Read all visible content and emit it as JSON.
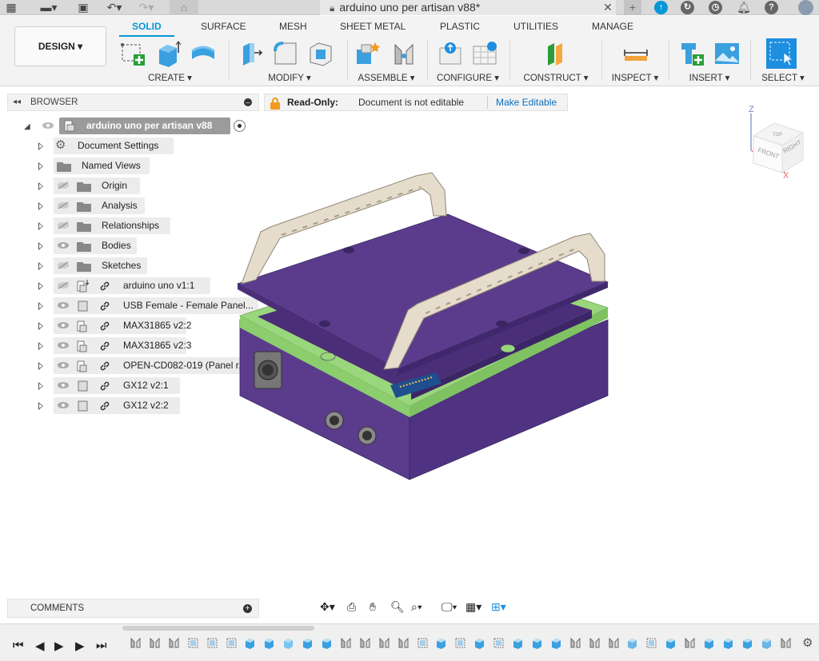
{
  "document": {
    "title": "arduino uno per artisan v88*"
  },
  "ribbon": {
    "workspace_label": "DESIGN",
    "tabs": [
      "SOLID",
      "SURFACE",
      "MESH",
      "SHEET METAL",
      "PLASTIC",
      "UTILITIES",
      "MANAGE"
    ],
    "groups": {
      "create": "CREATE",
      "modify": "MODIFY",
      "assemble": "ASSEMBLE",
      "configure": "CONFIGURE",
      "construct": "CONSTRUCT",
      "inspect": "INSPECT",
      "insert": "INSERT",
      "select": "SELECT"
    }
  },
  "browser": {
    "header": "BROWSER",
    "root": "arduino uno per artisan v88",
    "items": [
      {
        "label": "Document Settings"
      },
      {
        "label": "Named Views"
      },
      {
        "label": "Origin"
      },
      {
        "label": "Analysis"
      },
      {
        "label": "Relationships"
      },
      {
        "label": "Bodies"
      },
      {
        "label": "Sketches"
      },
      {
        "label": "arduino uno v1:1"
      },
      {
        "label": "USB Female - Female Panel..."
      },
      {
        "label": "MAX31865 v2:2"
      },
      {
        "label": "MAX31865 v2:3"
      },
      {
        "label": "OPEN-CD082-019 (Panel r..."
      },
      {
        "label": "GX12 v2:1"
      },
      {
        "label": "GX12 v2:2"
      }
    ]
  },
  "notice": {
    "bold": "Read-Only:",
    "message": "Document is not editable",
    "action": "Make Editable"
  },
  "viewcube": {
    "faces": [
      "TOP",
      "FRONT",
      "RIGHT"
    ],
    "axes": [
      "Z",
      "X"
    ]
  },
  "comments": {
    "header": "COMMENTS"
  },
  "colors": {
    "accent": "#0696d7",
    "enclosure": "#5b3c8c",
    "enclosure_dark": "#4a2f78",
    "gasket": "#9ad67c",
    "handle": "#e5dccb"
  }
}
